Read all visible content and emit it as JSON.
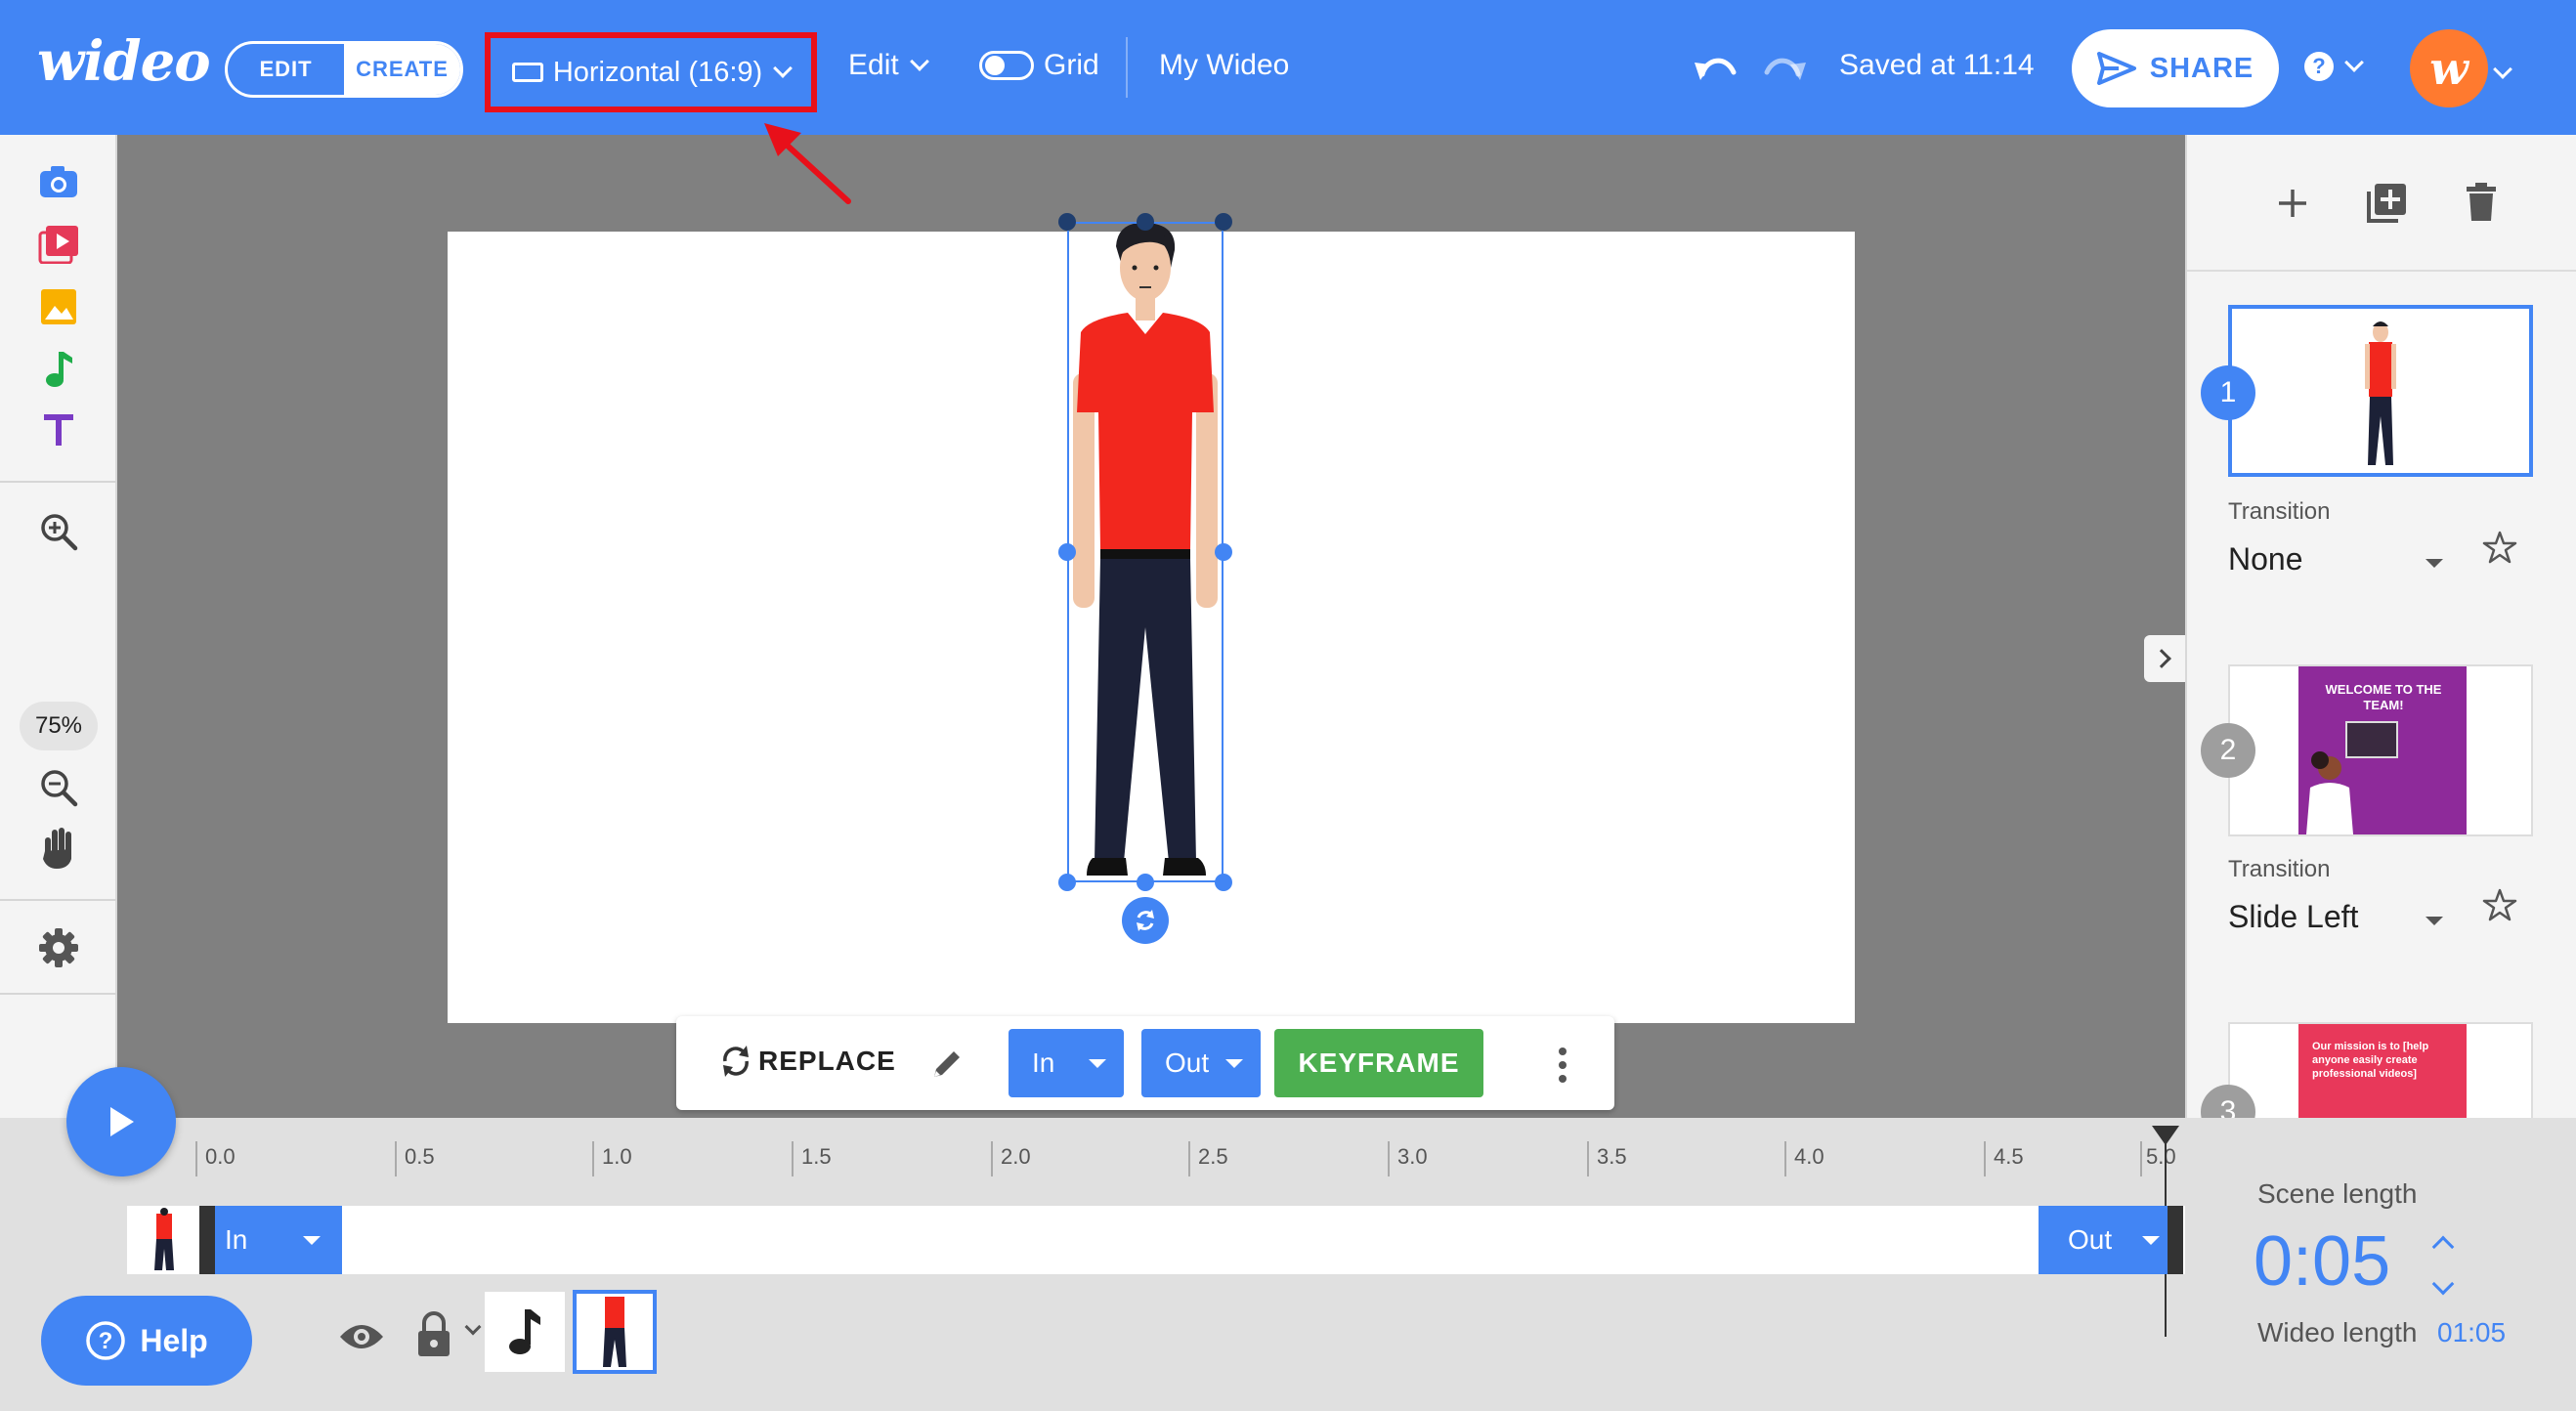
{
  "header": {
    "logo": "wideo",
    "mode_edit": "EDIT",
    "mode_create": "CREATE",
    "aspect_ratio": "Horizontal (16:9)",
    "edit_menu": "Edit",
    "grid_label": "Grid",
    "project_name": "My Wideo",
    "saved_status": "Saved at 11:14",
    "share_label": "SHARE",
    "help_glyph": "?",
    "avatar_letter": "w"
  },
  "left_toolbar": {
    "icons": [
      "camera-icon",
      "video-icon",
      "image-icon",
      "music-note-icon",
      "text-icon",
      "zoom-in-icon",
      "zoom-out-icon",
      "hand-icon",
      "gear-icon"
    ],
    "zoom_level": "75%"
  },
  "element_toolbar": {
    "replace_label": "REPLACE",
    "in_label": "In",
    "out_label": "Out",
    "keyframe_label": "KEYFRAME"
  },
  "scenes_panel": {
    "scenes": [
      {
        "number": "1",
        "transition_label": "Transition",
        "transition": "None",
        "active": true
      },
      {
        "number": "2",
        "transition_label": "Transition",
        "transition": "Slide Left",
        "thumb_title": "WELCOME TO THE TEAM!",
        "active": false
      },
      {
        "number": "3",
        "thumb_text": "Our mission is to [help anyone easily create professional videos]",
        "active": false
      }
    ]
  },
  "timeline": {
    "ticks": [
      "0.0",
      "0.5",
      "1.0",
      "1.5",
      "2.0",
      "2.5",
      "3.0",
      "3.5",
      "4.0",
      "4.5",
      "5.0"
    ],
    "in_label": "In",
    "out_label": "Out",
    "help_label": "Help"
  },
  "scene_length": {
    "label": "Scene length",
    "value": "0:05",
    "wideo_length_label": "Wideo length",
    "wideo_length_value": "01:05"
  },
  "colors": {
    "primary": "#4285f4",
    "highlight": "#e8101a",
    "keyframe": "#4caf50",
    "avatar": "#ff7a2f"
  }
}
